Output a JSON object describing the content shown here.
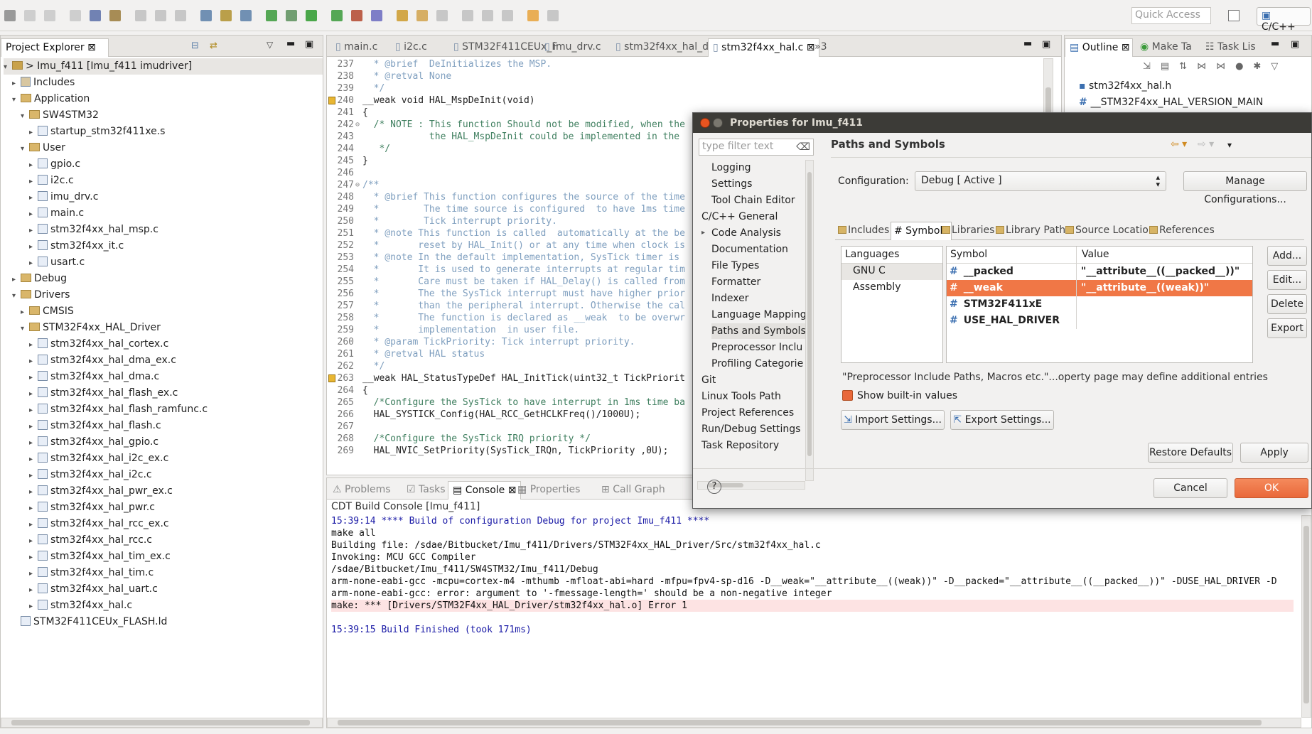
{
  "toolbar": {
    "quick_access_placeholder": "Quick Access",
    "perspective_label": "C/C++"
  },
  "project_explorer": {
    "tab_label": "Project Explorer",
    "items": [
      {
        "label": "> Imu_f411  [Imu_f411 imudriver]",
        "depth": 0,
        "arrow": "▾",
        "icon": "project",
        "selected": true
      },
      {
        "label": "Includes",
        "depth": 1,
        "arrow": "▸",
        "icon": "includes"
      },
      {
        "label": "Application",
        "depth": 1,
        "arrow": "▾",
        "icon": "folder"
      },
      {
        "label": "SW4STM32",
        "depth": 2,
        "arrow": "▾",
        "icon": "folder"
      },
      {
        "label": "startup_stm32f411xe.s",
        "depth": 3,
        "arrow": "▸",
        "icon": "file"
      },
      {
        "label": "User",
        "depth": 2,
        "arrow": "▾",
        "icon": "folder"
      },
      {
        "label": "gpio.c",
        "depth": 3,
        "arrow": "▸",
        "icon": "file"
      },
      {
        "label": "i2c.c",
        "depth": 3,
        "arrow": "▸",
        "icon": "file"
      },
      {
        "label": "imu_drv.c",
        "depth": 3,
        "arrow": "▸",
        "icon": "file"
      },
      {
        "label": "main.c",
        "depth": 3,
        "arrow": "▸",
        "icon": "file"
      },
      {
        "label": "stm32f4xx_hal_msp.c",
        "depth": 3,
        "arrow": "▸",
        "icon": "file"
      },
      {
        "label": "stm32f4xx_it.c",
        "depth": 3,
        "arrow": "▸",
        "icon": "file"
      },
      {
        "label": "usart.c",
        "depth": 3,
        "arrow": "▸",
        "icon": "file"
      },
      {
        "label": "Debug",
        "depth": 1,
        "arrow": "▸",
        "icon": "folder"
      },
      {
        "label": "Drivers",
        "depth": 1,
        "arrow": "▾",
        "icon": "folder"
      },
      {
        "label": "CMSIS",
        "depth": 2,
        "arrow": "▸",
        "icon": "folder"
      },
      {
        "label": "STM32F4xx_HAL_Driver",
        "depth": 2,
        "arrow": "▾",
        "icon": "folder"
      },
      {
        "label": "stm32f4xx_hal_cortex.c",
        "depth": 3,
        "arrow": "▸",
        "icon": "file"
      },
      {
        "label": "stm32f4xx_hal_dma_ex.c",
        "depth": 3,
        "arrow": "▸",
        "icon": "file"
      },
      {
        "label": "stm32f4xx_hal_dma.c",
        "depth": 3,
        "arrow": "▸",
        "icon": "file"
      },
      {
        "label": "stm32f4xx_hal_flash_ex.c",
        "depth": 3,
        "arrow": "▸",
        "icon": "file"
      },
      {
        "label": "stm32f4xx_hal_flash_ramfunc.c",
        "depth": 3,
        "arrow": "▸",
        "icon": "file"
      },
      {
        "label": "stm32f4xx_hal_flash.c",
        "depth": 3,
        "arrow": "▸",
        "icon": "file"
      },
      {
        "label": "stm32f4xx_hal_gpio.c",
        "depth": 3,
        "arrow": "▸",
        "icon": "file"
      },
      {
        "label": "stm32f4xx_hal_i2c_ex.c",
        "depth": 3,
        "arrow": "▸",
        "icon": "file"
      },
      {
        "label": "stm32f4xx_hal_i2c.c",
        "depth": 3,
        "arrow": "▸",
        "icon": "file"
      },
      {
        "label": "stm32f4xx_hal_pwr_ex.c",
        "depth": 3,
        "arrow": "▸",
        "icon": "file"
      },
      {
        "label": "stm32f4xx_hal_pwr.c",
        "depth": 3,
        "arrow": "▸",
        "icon": "file"
      },
      {
        "label": "stm32f4xx_hal_rcc_ex.c",
        "depth": 3,
        "arrow": "▸",
        "icon": "file"
      },
      {
        "label": "stm32f4xx_hal_rcc.c",
        "depth": 3,
        "arrow": "▸",
        "icon": "file"
      },
      {
        "label": "stm32f4xx_hal_tim_ex.c",
        "depth": 3,
        "arrow": "▸",
        "icon": "file"
      },
      {
        "label": "stm32f4xx_hal_tim.c",
        "depth": 3,
        "arrow": "▸",
        "icon": "file"
      },
      {
        "label": "stm32f4xx_hal_uart.c",
        "depth": 3,
        "arrow": "▸",
        "icon": "file"
      },
      {
        "label": "stm32f4xx_hal.c",
        "depth": 3,
        "arrow": "▸",
        "icon": "file"
      },
      {
        "label": "STM32F411CEUx_FLASH.ld",
        "depth": 1,
        "arrow": "",
        "icon": "file"
      }
    ]
  },
  "editor": {
    "tabs": [
      "main.c",
      "i2c.c",
      "STM32F411CEUx_F",
      "imu_drv.c",
      "stm32f4xx_hal_d",
      "stm32f4xx_hal.c",
      "»3"
    ],
    "active_tab": 5,
    "lines": [
      {
        "no": "237",
        "text": "  * @brief  DeInitializes the MSP.",
        "cls": "jd"
      },
      {
        "no": "238",
        "text": "  * @retval None",
        "cls": "jd"
      },
      {
        "no": "239",
        "text": "  */",
        "cls": "jd"
      },
      {
        "no": "240",
        "text": "__weak void HAL_MspDeInit(void)",
        "cls": "",
        "marker": true
      },
      {
        "no": "241",
        "text": "{",
        "cls": ""
      },
      {
        "no": "242",
        "text": "  /* NOTE : This function Should not be modified, when the",
        "cls": "cm",
        "fold": true
      },
      {
        "no": "243",
        "text": "            the HAL_MspDeInit could be implemented in the",
        "cls": "cm"
      },
      {
        "no": "244",
        "text": "   */",
        "cls": "cm"
      },
      {
        "no": "245",
        "text": "}",
        "cls": ""
      },
      {
        "no": "246",
        "text": "",
        "cls": ""
      },
      {
        "no": "247",
        "text": "/**",
        "cls": "jd",
        "fold": true
      },
      {
        "no": "248",
        "text": "  * @brief This function configures the source of the time",
        "cls": "jd"
      },
      {
        "no": "249",
        "text": "  *        The time source is configured  to have 1ms time",
        "cls": "jd"
      },
      {
        "no": "250",
        "text": "  *        Tick interrupt priority.",
        "cls": "jd"
      },
      {
        "no": "251",
        "text": "  * @note This function is called  automatically at the be",
        "cls": "jd"
      },
      {
        "no": "252",
        "text": "  *       reset by HAL_Init() or at any time when clock is",
        "cls": "jd"
      },
      {
        "no": "253",
        "text": "  * @note In the default implementation, SysTick timer is",
        "cls": "jd"
      },
      {
        "no": "254",
        "text": "  *       It is used to generate interrupts at regular tim",
        "cls": "jd"
      },
      {
        "no": "255",
        "text": "  *       Care must be taken if HAL_Delay() is called from",
        "cls": "jd"
      },
      {
        "no": "256",
        "text": "  *       The the SysTick interrupt must have higher prior",
        "cls": "jd"
      },
      {
        "no": "257",
        "text": "  *       than the peripheral interrupt. Otherwise the cal",
        "cls": "jd"
      },
      {
        "no": "258",
        "text": "  *       The function is declared as __weak  to be overwr",
        "cls": "jd"
      },
      {
        "no": "259",
        "text": "  *       implementation  in user file.",
        "cls": "jd"
      },
      {
        "no": "260",
        "text": "  * @param TickPriority: Tick interrupt priority.",
        "cls": "jd"
      },
      {
        "no": "261",
        "text": "  * @retval HAL status",
        "cls": "jd"
      },
      {
        "no": "262",
        "text": "  */",
        "cls": "jd"
      },
      {
        "no": "263",
        "text": "__weak HAL_StatusTypeDef HAL_InitTick(uint32_t TickPriorit",
        "cls": "",
        "marker": true
      },
      {
        "no": "264",
        "text": "{",
        "cls": ""
      },
      {
        "no": "265",
        "text": "  /*Configure the SysTick to have interrupt in 1ms time ba",
        "cls": "cm"
      },
      {
        "no": "266",
        "text": "  HAL_SYSTICK_Config(HAL_RCC_GetHCLKFreq()/1000U);",
        "cls": ""
      },
      {
        "no": "267",
        "text": "",
        "cls": ""
      },
      {
        "no": "268",
        "text": "  /*Configure the SysTick IRQ priority */",
        "cls": "cm"
      },
      {
        "no": "269",
        "text": "  HAL_NVIC_SetPriority(SysTick_IRQn, TickPriority ,0U);",
        "cls": ""
      }
    ]
  },
  "outline": {
    "tabs": [
      "Outline",
      "Make Ta",
      "Task Lis"
    ],
    "items": [
      "stm32f4xx_hal.h",
      "__STM32F4xx_HAL_VERSION_MAIN"
    ]
  },
  "bottom": {
    "tabs": [
      "Problems",
      "Tasks",
      "Console",
      "Properties",
      "Call Graph"
    ],
    "active_tab": 2,
    "console_title": "CDT Build Console [Imu_f411]",
    "lines": [
      {
        "text": "15:39:14 **** Build of configuration Debug for project Imu_f411 ****",
        "color": "#1a1aa6"
      },
      {
        "text": "make all",
        "color": "#111111"
      },
      {
        "text": "Building file: /sdae/Bitbucket/Imu_f411/Drivers/STM32F4xx_HAL_Driver/Src/stm32f4xx_hal.c",
        "color": "#111111"
      },
      {
        "text": "Invoking: MCU GCC Compiler",
        "color": "#111111"
      },
      {
        "text": "/sdae/Bitbucket/Imu_f411/SW4STM32/Imu_f411/Debug",
        "color": "#111111"
      },
      {
        "text": "arm-none-eabi-gcc -mcpu=cortex-m4 -mthumb -mfloat-abi=hard -mfpu=fpv4-sp-d16 -D__weak=\"__attribute__((weak))\" -D__packed=\"__attribute__((__packed__))\" -DUSE_HAL_DRIVER -D",
        "color": "#111111"
      },
      {
        "text": "arm-none-eabi-gcc: error: argument to '-fmessage-length=' should be a non-negative integer",
        "color": "#111111"
      },
      {
        "text": "make: *** [Drivers/STM32F4xx_HAL_Driver/stm32f4xx_hal.o] Error 1",
        "color": "#111111",
        "error": true
      },
      {
        "text": "",
        "color": "#111111"
      },
      {
        "text": "15:39:15 Build Finished (took 171ms)",
        "color": "#1a1aa6"
      }
    ]
  },
  "dialog": {
    "title": "Properties for Imu_f411",
    "filter_placeholder": "type filter text",
    "nav": [
      {
        "label": "Logging",
        "indent": 1
      },
      {
        "label": "Settings",
        "indent": 1
      },
      {
        "label": "Tool Chain Editor",
        "indent": 1
      },
      {
        "label": "C/C++ General",
        "indent": 0,
        "arrow": "▾"
      },
      {
        "label": "Code Analysis",
        "indent": 1,
        "arrow": "▸"
      },
      {
        "label": "Documentation",
        "indent": 1
      },
      {
        "label": "File Types",
        "indent": 1
      },
      {
        "label": "Formatter",
        "indent": 1
      },
      {
        "label": "Indexer",
        "indent": 1
      },
      {
        "label": "Language Mapping",
        "indent": 1
      },
      {
        "label": "Paths and Symbols",
        "indent": 1,
        "selected": true
      },
      {
        "label": "Preprocessor Inclu",
        "indent": 1
      },
      {
        "label": "Profiling Categorie",
        "indent": 1
      },
      {
        "label": "Git",
        "indent": 0
      },
      {
        "label": "Linux Tools Path",
        "indent": 0
      },
      {
        "label": "Project References",
        "indent": 0
      },
      {
        "label": "Run/Debug Settings",
        "indent": 0
      },
      {
        "label": "Task Repository",
        "indent": 0,
        "arrow": "▸"
      }
    ],
    "page_title": "Paths and Symbols",
    "config_label": "Configuration:",
    "config_value": "Debug [ Active ]",
    "manage_label": "Manage Configurations...",
    "tabs": [
      "Includes",
      "# Symbols",
      "Libraries",
      "Library Paths",
      "Source Location",
      "References"
    ],
    "active_tab": 1,
    "languages_header": "Languages",
    "languages": [
      "GNU C",
      "Assembly"
    ],
    "symbol_header": "Symbol",
    "value_header": "Value",
    "symbols": [
      {
        "name": "__packed",
        "value": "\"__attribute__((__packed__))\""
      },
      {
        "name": "__weak",
        "value": "\"__attribute__((weak))\"",
        "selected": true
      },
      {
        "name": "STM32F411xE",
        "value": ""
      },
      {
        "name": "USE_HAL_DRIVER",
        "value": ""
      }
    ],
    "side_buttons": [
      "Add...",
      "Edit...",
      "Delete",
      "Export"
    ],
    "note": "\"Preprocessor Include Paths, Macros etc.\"...operty page may define additional entries",
    "show_builtin": "Show built-in values",
    "import_label": "Import Settings...",
    "export_label": "Export Settings...",
    "restore_label": "Restore Defaults",
    "apply_label": "Apply",
    "cancel_label": "Cancel",
    "ok_label": "OK"
  }
}
